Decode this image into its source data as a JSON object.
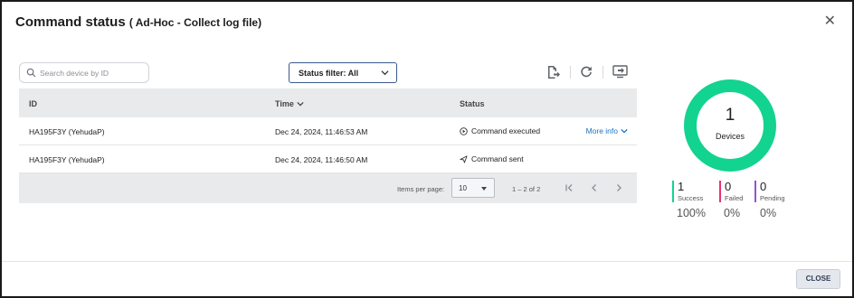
{
  "dialog": {
    "title": "Command status",
    "subtitle": "( Ad-Hoc - Collect log file)",
    "close_icon": "close-icon"
  },
  "toolbar": {
    "search_placeholder": "Search device by ID",
    "search_value": "",
    "status_filter_label": "Status filter: All",
    "icons": [
      "export-icon",
      "refresh-icon",
      "remote-screen-icon"
    ]
  },
  "table": {
    "columns": {
      "id": "ID",
      "time": "Time",
      "status": "Status"
    },
    "rows": [
      {
        "id": "HA195F3Y (YehudaP)",
        "time": "Dec 24, 2024, 11:46:53 AM",
        "status": "Command executed",
        "status_icon": "play-circle-icon",
        "more_info": "More info"
      },
      {
        "id": "HA195F3Y (YehudaP)",
        "time": "Dec 24, 2024, 11:46:50 AM",
        "status": "Command sent",
        "status_icon": "send-icon",
        "more_info": ""
      }
    ],
    "pagination": {
      "items_per_page_label": "Items per page:",
      "items_per_page": "10",
      "range": "1 – 2 of 2"
    }
  },
  "summary": {
    "total": "1",
    "total_label": "Devices",
    "ring_color": "#12d38f",
    "stats": [
      {
        "count": "1",
        "label": "Success",
        "percent": "100%",
        "color": "#12d38f"
      },
      {
        "count": "0",
        "label": "Failed",
        "percent": "0%",
        "color": "#e8336b"
      },
      {
        "count": "0",
        "label": "Pending",
        "percent": "0%",
        "color": "#9b4fd1"
      }
    ]
  },
  "footer": {
    "close_label": "CLOSE"
  }
}
